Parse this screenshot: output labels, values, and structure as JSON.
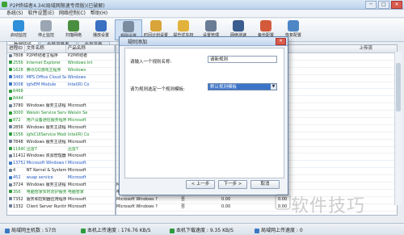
{
  "window": {
    "title": "P2P终结者4.34(局域网限速专用版)(已破解)",
    "controls": [
      "─",
      "□",
      "✕"
    ]
  },
  "menu": [
    "系统(S)",
    "软件设置(E)",
    "网络控制(C)",
    "帮助(H)"
  ],
  "toolbar": [
    {
      "label": "启动监控",
      "icon": "monitor-icon",
      "color": "#2f8fd8"
    },
    {
      "label": "停止监控",
      "icon": "stop-icon",
      "color": "#9aa6b3"
    },
    {
      "label": "扫描网络",
      "icon": "scan-icon",
      "color": "#4a8f3f"
    },
    {
      "label": "播放设置",
      "icon": "play-icon",
      "color": "#3a6fc2"
    },
    {
      "label": "规则设置",
      "icon": "rules-icon",
      "color": "#7c8ca0"
    },
    {
      "label": "时间计划设置",
      "icon": "clock-icon",
      "color": "#d8a53a"
    },
    {
      "label": "提升优先权",
      "icon": "priority-icon",
      "color": "#e2b23c"
    },
    {
      "label": "设置管理",
      "icon": "settings-icon",
      "color": "#6a7c95"
    },
    {
      "label": "网络测速",
      "icon": "speed-icon",
      "color": "#3b5d8f"
    },
    {
      "label": "备份配置",
      "icon": "backup-icon",
      "color": "#d45a3c"
    },
    {
      "label": "恢复配置",
      "icon": "restore-icon",
      "color": "#4e86c6"
    }
  ],
  "tabs": [
    "数据链接",
    "全局流量表",
    "全部流量"
  ],
  "left_table": {
    "headers": [
      "进程ID",
      "文件名称",
      "产品名称"
    ],
    "rows": [
      {
        "pid": "7808",
        "file": "P2P终结者主程序",
        "product": "P2P终结者",
        "style": ""
      },
      {
        "pid": "2556",
        "file": "Internet Explorer",
        "product": "Windows Int",
        "style": "green"
      },
      {
        "pid": "1628",
        "file": "腾讯QQ游戏主程序",
        "product": "Windows",
        "style": "green"
      },
      {
        "pid": "3460",
        "file": "MPS Office Cloud Service",
        "product": "Windows",
        "style": "blue"
      },
      {
        "pid": "3008",
        "file": "igfxEM Module",
        "product": "Intel(R) Co",
        "style": "blue"
      },
      {
        "pid": "6468",
        "file": "",
        "product": "",
        "style": "green"
      },
      {
        "pid": "8444",
        "file": "",
        "product": "",
        "style": "green"
      },
      {
        "pid": "3780",
        "file": "Windows 服务主进程",
        "product": "Microsoft",
        "style": ""
      },
      {
        "pid": "3000",
        "file": "Weixin Service Server",
        "product": "Weixin Se",
        "style": "green"
      },
      {
        "pid": "872",
        "file": "用户设备通信服务程序",
        "product": "Microsoft",
        "style": "green"
      },
      {
        "pid": "2856",
        "file": "Windows 服务主进程",
        "product": "Microsoft",
        "style": ""
      },
      {
        "pid": "1556",
        "file": "igfxCUIService Module",
        "product": "Intel(R) Co",
        "style": "green"
      },
      {
        "pid": "7848",
        "file": "Windows 服务主进程",
        "product": "Microsoft",
        "style": ""
      },
      {
        "pid": "11640",
        "file": "迅雷7",
        "product": "迅雷7",
        "style": "green"
      },
      {
        "pid": "11412",
        "file": "Windows 资源管理器",
        "product": "Microsoft",
        "style": ""
      },
      {
        "pid": "13752",
        "file": "Microsoft Windows L...",
        "product": "Microsoft",
        "style": "blue"
      },
      {
        "pid": "4",
        "file": "NT Kernel & System",
        "product": "Microsoft",
        "style": ""
      },
      {
        "pid": "452",
        "file": "wuap service",
        "product": "Microsoft",
        "style": "blue"
      },
      {
        "pid": "3724",
        "file": "Windows 服务主进程",
        "product": "Microsoft",
        "style": ""
      },
      {
        "pid": "356",
        "file": "电脑管家实时防护服务",
        "product": "电脑管家",
        "style": "green"
      },
      {
        "pid": "7352",
        "file": "服务和控制器应用程序",
        "product": "Microsoft",
        "style": ""
      },
      {
        "pid": "1332",
        "file": "Client Server Runtime ...",
        "product": "Microsoft",
        "style": ""
      }
    ]
  },
  "right_table": {
    "header_right": "上传流",
    "rows": [
      {
        "pid": "",
        "a": "",
        "b": "",
        "c": "",
        "d": ""
      },
      {
        "pid": "",
        "a": "",
        "b": "",
        "c": "",
        "d": ""
      },
      {
        "pid": "",
        "a": "",
        "b": "",
        "c": "",
        "d": ""
      },
      {
        "pid": "",
        "a": "",
        "b": "",
        "c": "",
        "d": ""
      },
      {
        "pid": "",
        "a": "",
        "b": "",
        "c": "",
        "d": ""
      },
      {
        "pid": "",
        "a": "",
        "b": "",
        "c": "",
        "d": ""
      },
      {
        "pid": "",
        "a": "",
        "b": "",
        "c": "",
        "d": ""
      },
      {
        "pid": "",
        "a": "",
        "b": "",
        "c": "",
        "d": ""
      },
      {
        "pid": "",
        "a": "",
        "b": "",
        "c": "",
        "d": ""
      },
      {
        "pid": "",
        "a": "",
        "b": "",
        "c": "",
        "d": ""
      },
      {
        "pid": "",
        "a": "",
        "b": "",
        "c": "",
        "d": ""
      },
      {
        "pid": "",
        "a": "",
        "b": "",
        "c": "",
        "d": ""
      },
      {
        "pid": "",
        "a": "",
        "b": "",
        "c": "",
        "d": ""
      },
      {
        "pid": "",
        "a": "",
        "b": "",
        "c": "",
        "d": ""
      },
      {
        "pid": "",
        "a": "",
        "b": "",
        "c": "",
        "d": ""
      },
      {
        "pid": "",
        "a": "",
        "b": "",
        "c": "",
        "d": ""
      },
      {
        "pid": "",
        "a": "",
        "b": "",
        "c": "",
        "d": ""
      },
      {
        "pid": "",
        "a": "",
        "b": "",
        "c": "",
        "d": ""
      },
      {
        "pid": "",
        "a": "Microsoft Windows ?",
        "b": "否",
        "c": "0.00",
        "d": "0.00"
      },
      {
        "pid": "",
        "a": "电脑管家",
        "b": "否",
        "c": "0.00",
        "d": "0.00"
      },
      {
        "pid": "",
        "a": "Microsoft Windows ?",
        "b": "否",
        "c": "0.00",
        "d": "0.00"
      },
      {
        "pid": "",
        "a": "Microsoft Windows ?",
        "b": "否",
        "c": "0.00",
        "d": "0.00"
      }
    ]
  },
  "dialog": {
    "title": "规则添加",
    "label_name": "请输入一个规则名称:",
    "name_value": "请新规则",
    "label_template": "请为规则选定一个规则模板:",
    "template_value": "默认规则模板",
    "buttons": [
      "< 上一步",
      "下一步 >",
      "取消"
    ]
  },
  "status": {
    "hosts": "局域网主机数 : 57台",
    "upload": "本机上传速度 : 176.76 KB/S",
    "download": "本机下载速度 : 9.35 KB/S",
    "lan_upload": "局域网上传速度 : 0"
  },
  "watermark": "软件技巧"
}
